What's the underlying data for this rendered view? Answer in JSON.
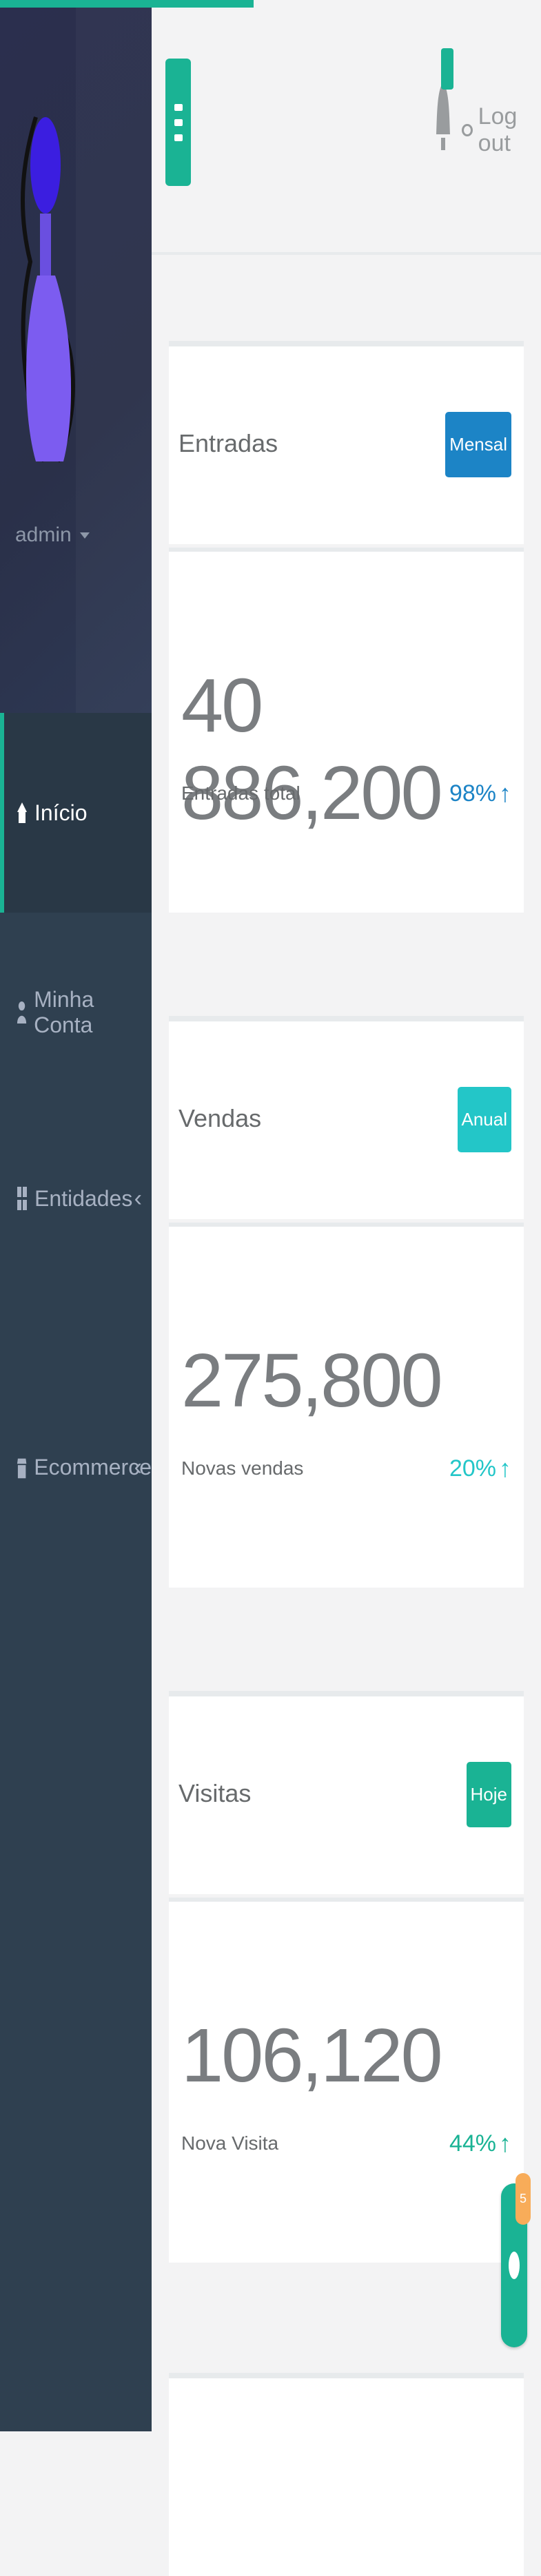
{
  "progress_color": "#1ab394",
  "sidebar": {
    "profile_name": "admin",
    "items": [
      {
        "label": "Início",
        "icon": "home-icon",
        "active": true,
        "has_children": false
      },
      {
        "label": "Minha Conta",
        "icon": "user-icon",
        "active": false,
        "has_children": false
      },
      {
        "label": "Entidades",
        "icon": "grid-icon",
        "active": false,
        "has_children": true
      },
      {
        "label": "Ecommerce",
        "icon": "store-icon",
        "active": false,
        "has_children": true
      }
    ]
  },
  "topbar": {
    "logout_label": "Log out"
  },
  "widgets": [
    {
      "title": "Entradas",
      "badge": "Mensal",
      "badge_color": "#1c84c6",
      "value": "40 886,200",
      "pct": "98%",
      "pct_color": "#1c84c6",
      "caption": "Entradas total"
    },
    {
      "title": "Vendas",
      "badge": "Anual",
      "badge_color": "#23c6c8",
      "value": "275,800",
      "pct": "20%",
      "pct_color": "#23c6c8",
      "caption": "Novas vendas"
    },
    {
      "title": "Visitas",
      "badge": "Hoje",
      "badge_color": "#1ab394",
      "value": "106,120",
      "pct": "44%",
      "pct_color": "#1ab394",
      "caption": "Nova Visita"
    }
  ],
  "chat": {
    "badge": "5"
  }
}
